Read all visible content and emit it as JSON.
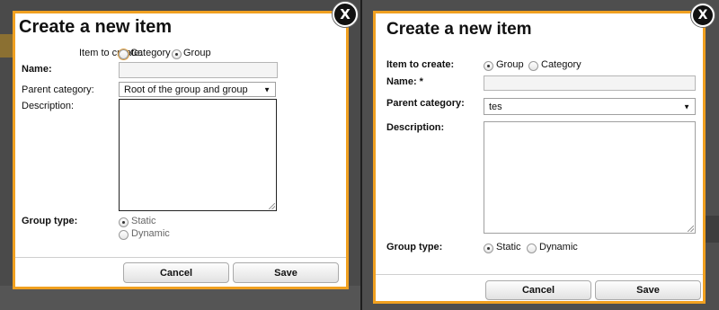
{
  "left": {
    "title": "Create a new item",
    "close": "X",
    "item_to_create_label": "Item to create:",
    "option_category": "Category",
    "option_group": "Group",
    "name_label": "Name:",
    "parent_category_label": "Parent category:",
    "parent_category_value": "Root of the group and group",
    "description_label": "Description:",
    "group_type_label": "Group type:",
    "group_type_static": "Static",
    "group_type_dynamic": "Dynamic",
    "cancel": "Cancel",
    "save": "Save",
    "selected_item_type": "Group",
    "selected_group_type": "Static"
  },
  "right": {
    "title": "Create a new item",
    "close": "X",
    "item_to_create_label": "Item to create:",
    "option_group": "Group",
    "option_category": "Category",
    "name_label": "Name: *",
    "parent_category_label": "Parent category:",
    "parent_category_value": "tes",
    "description_label": "Description:",
    "group_type_label": "Group type:",
    "group_type_static": "Static",
    "group_type_dynamic": "Dynamic",
    "cancel": "Cancel",
    "save": "Save",
    "selected_item_type": "Group",
    "selected_group_type": "Static"
  },
  "colors": {
    "dialog_border": "#f0a020",
    "overlay": "#4a4a4a"
  }
}
